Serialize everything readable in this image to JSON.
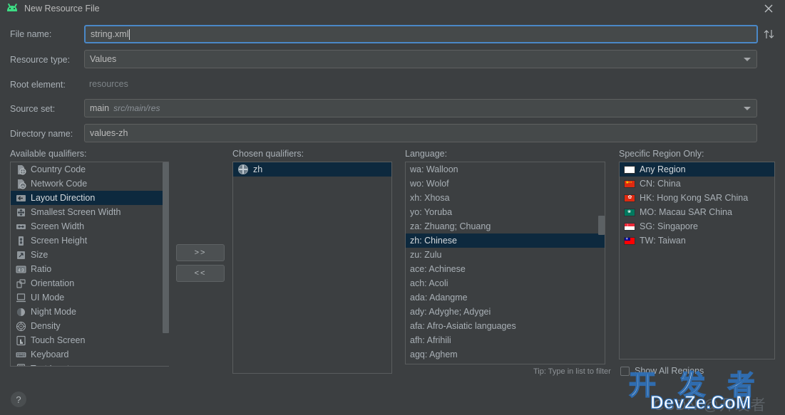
{
  "window": {
    "title": "New Resource File",
    "app_icon": "android-robot-icon",
    "close_label": "×"
  },
  "form": {
    "file_name": {
      "label": "File name:",
      "value": "string.xml",
      "focused": true
    },
    "resource_type": {
      "label": "Resource type:",
      "value": "Values",
      "icon": "chevron-down-icon"
    },
    "root_element": {
      "label": "Root element:",
      "value": "resources"
    },
    "source_set": {
      "label": "Source set:",
      "value": "main",
      "path": "src/main/res",
      "icon": "chevron-down-icon"
    },
    "directory_name": {
      "label": "Directory name:",
      "value": "values-zh"
    },
    "swap_icon": "swap-up-down-icon"
  },
  "available_qualifiers": {
    "label": "Available qualifiers:",
    "items": [
      {
        "label": "Country Code",
        "icon": "country-code-icon",
        "selected": false
      },
      {
        "label": "Network Code",
        "icon": "network-code-icon",
        "selected": false
      },
      {
        "label": "Layout Direction",
        "icon": "layout-direction-icon",
        "selected": true
      },
      {
        "label": "Smallest Screen Width",
        "icon": "smallest-screen-width-icon",
        "selected": false
      },
      {
        "label": "Screen Width",
        "icon": "screen-width-icon",
        "selected": false
      },
      {
        "label": "Screen Height",
        "icon": "screen-height-icon",
        "selected": false
      },
      {
        "label": "Size",
        "icon": "size-icon",
        "selected": false
      },
      {
        "label": "Ratio",
        "icon": "ratio-icon",
        "selected": false
      },
      {
        "label": "Orientation",
        "icon": "orientation-icon",
        "selected": false
      },
      {
        "label": "UI Mode",
        "icon": "ui-mode-icon",
        "selected": false
      },
      {
        "label": "Night Mode",
        "icon": "night-mode-icon",
        "selected": false
      },
      {
        "label": "Density",
        "icon": "density-icon",
        "selected": false
      },
      {
        "label": "Touch Screen",
        "icon": "touch-screen-icon",
        "selected": false
      },
      {
        "label": "Keyboard",
        "icon": "keyboard-icon",
        "selected": false
      },
      {
        "label": "Text Input",
        "icon": "text-input-icon",
        "selected": false
      }
    ]
  },
  "transfer": {
    "add_label": ">>",
    "remove_label": "<<"
  },
  "chosen_qualifiers": {
    "label": "Chosen qualifiers:",
    "items": [
      {
        "label": "zh",
        "icon": "globe-icon",
        "selected": true
      }
    ]
  },
  "language": {
    "label": "Language:",
    "tip": "Tip: Type in list to filter",
    "items": [
      {
        "label": "wa: Walloon",
        "selected": false
      },
      {
        "label": "wo: Wolof",
        "selected": false
      },
      {
        "label": "xh: Xhosa",
        "selected": false
      },
      {
        "label": "yo: Yoruba",
        "selected": false
      },
      {
        "label": "za: Zhuang; Chuang",
        "selected": false
      },
      {
        "label": "zh: Chinese",
        "selected": true
      },
      {
        "label": "zu: Zulu",
        "selected": false
      },
      {
        "label": "ace: Achinese",
        "selected": false
      },
      {
        "label": "ach: Acoli",
        "selected": false
      },
      {
        "label": "ada: Adangme",
        "selected": false
      },
      {
        "label": "ady: Adyghe; Adygei",
        "selected": false
      },
      {
        "label": "afa: Afro-Asiatic languages",
        "selected": false
      },
      {
        "label": "afh: Afrihili",
        "selected": false
      },
      {
        "label": "agq: Aghem",
        "selected": false
      }
    ]
  },
  "region": {
    "label": "Specific Region Only:",
    "items": [
      {
        "label": "Any Region",
        "flag": "blank-flag-icon",
        "selected": true
      },
      {
        "label": "CN: China",
        "flag": "china-flag-icon",
        "selected": false
      },
      {
        "label": "HK: Hong Kong SAR China",
        "flag": "hongkong-flag-icon",
        "selected": false
      },
      {
        "label": "MO: Macau SAR China",
        "flag": "macau-flag-icon",
        "selected": false
      },
      {
        "label": "SG: Singapore",
        "flag": "singapore-flag-icon",
        "selected": false
      },
      {
        "label": "TW: Taiwan",
        "flag": "taiwan-flag-icon",
        "selected": false
      }
    ],
    "show_all_label": "Show All Regions",
    "show_all_checked": false
  },
  "help": {
    "label": "?"
  },
  "watermark": {
    "chinese": "开 发 者",
    "site": "DevZe.CoM",
    "backdrop": "CSDN @开发者"
  },
  "colors": {
    "background": "#3c3f41",
    "selection": "#0d293e",
    "focus_border": "#4a88c7",
    "text": "#a9b0b6",
    "accent_green": "#3ddc84"
  }
}
